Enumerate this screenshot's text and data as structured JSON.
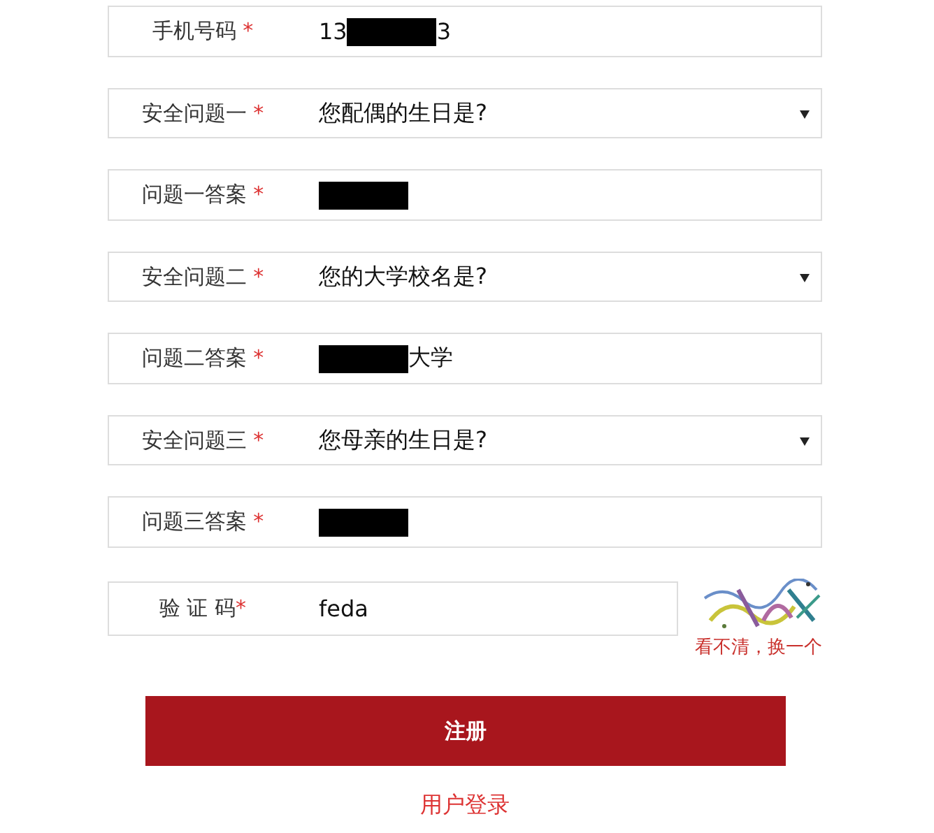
{
  "fields": [
    {
      "kind": "text",
      "label": "手机号码",
      "mark": "*",
      "value": [
        {
          "kind": "text",
          "text": "13"
        },
        {
          "kind": "redacted"
        },
        {
          "kind": "text",
          "text": "3"
        }
      ]
    },
    {
      "kind": "select",
      "label": "安全问题一",
      "mark": "*",
      "value": [
        {
          "kind": "text",
          "text": "您配偶的生日是?"
        }
      ]
    },
    {
      "kind": "text",
      "label": "问题一答案",
      "mark": "*",
      "value": [
        {
          "kind": "redacted"
        }
      ]
    },
    {
      "kind": "select",
      "label": "安全问题二",
      "mark": "*",
      "value": [
        {
          "kind": "text",
          "text": "您的大学校名是?"
        }
      ]
    },
    {
      "kind": "text",
      "label": "问题二答案",
      "mark": "*",
      "value": [
        {
          "kind": "redacted"
        },
        {
          "kind": "text",
          "text": "大学"
        }
      ]
    },
    {
      "kind": "select",
      "label": "安全问题三",
      "mark": "*",
      "value": [
        {
          "kind": "text",
          "text": "您母亲的生日是?"
        }
      ]
    },
    {
      "kind": "text",
      "label": "问题三答案",
      "mark": "*",
      "value": [
        {
          "kind": "redacted"
        }
      ]
    }
  ],
  "captcha": {
    "label": "验 证 码",
    "mark": "*",
    "value": "feda",
    "refresh_link": "看不清，换一个"
  },
  "submit_button": "注册",
  "login_link": "用户登录"
}
